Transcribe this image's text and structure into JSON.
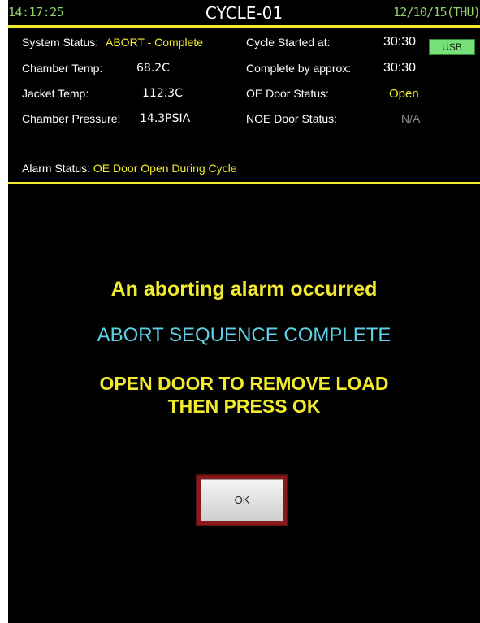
{
  "header": {
    "time": "14:17:25",
    "title": "CYCLE-01",
    "date": "12/10/15(THU)"
  },
  "status": {
    "system_status_label": "System Status:",
    "system_status_value": "ABORT - Complete",
    "chamber_temp_label": "Chamber Temp:",
    "chamber_temp_value": "68.2C",
    "jacket_temp_label": "Jacket Temp:",
    "jacket_temp_value": "112.3C",
    "chamber_pressure_label": "Chamber Pressure:",
    "chamber_pressure_value": "14.3PSIA",
    "cycle_started_label": "Cycle Started at:",
    "cycle_started_value": "30:30",
    "complete_by_label": "Complete by approx:",
    "complete_by_value": "30:30",
    "oe_door_label": "OE Door Status:",
    "oe_door_value": "Open",
    "noe_door_label": "NOE Door Status:",
    "noe_door_value": "N/A",
    "usb_label": "USB",
    "alarm_status_label": "Alarm Status:",
    "alarm_status_value": "OE Door Open During Cycle"
  },
  "message": {
    "alarm_line": "An aborting alarm occurred",
    "sequence_line": "ABORT SEQUENCE COMPLETE",
    "instruction_line1": "OPEN DOOR TO REMOVE LOAD",
    "instruction_line2": "THEN PRESS OK",
    "ok_label": "OK"
  },
  "colors": {
    "background": "#000000",
    "accent_yellow": "#f2ea2c",
    "accent_cyan": "#5ed1e6",
    "clock_green": "#8fd46a",
    "usb_green": "#78e07a",
    "ok_frame": "#8a1a1a"
  }
}
